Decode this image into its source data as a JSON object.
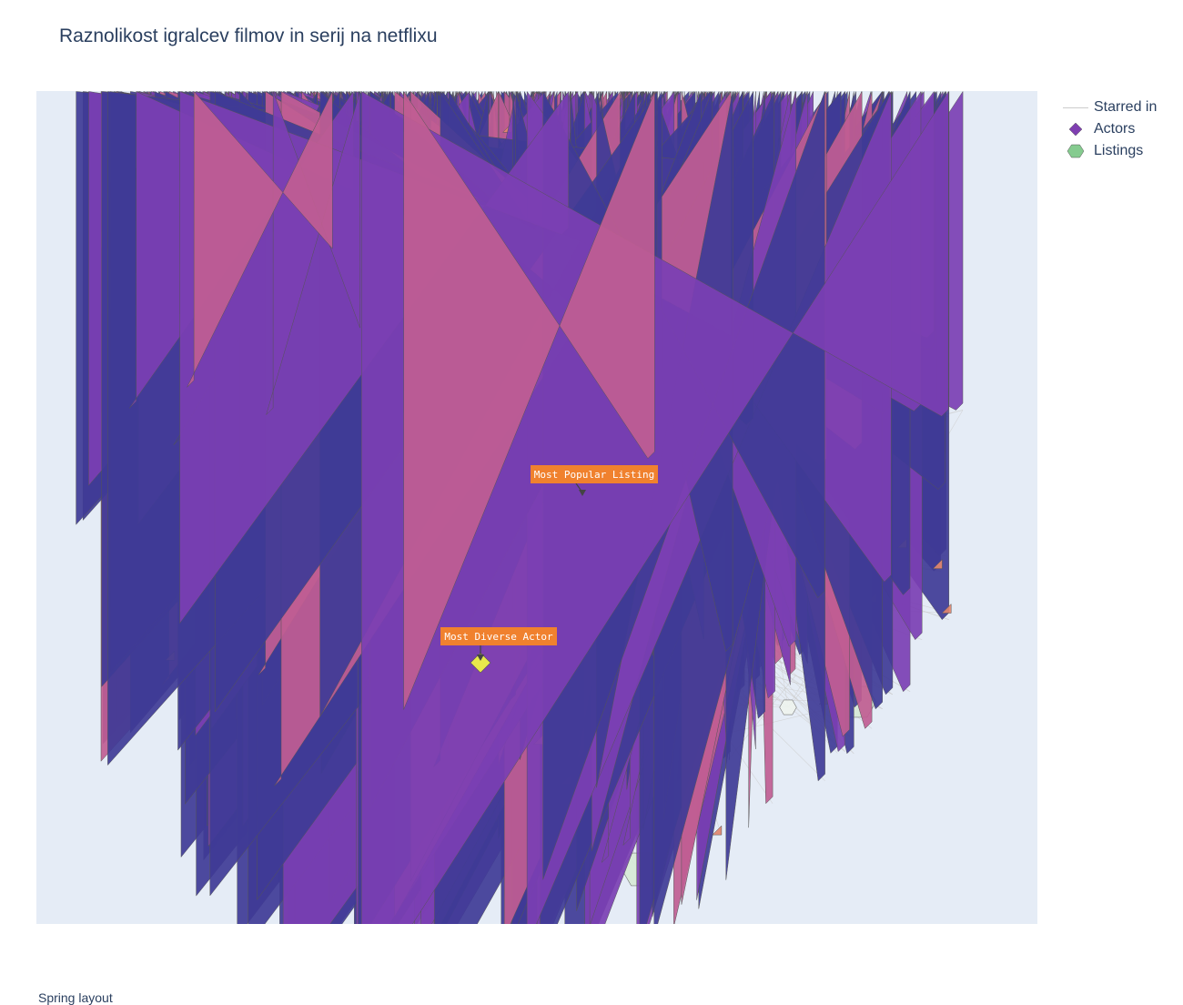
{
  "chart_data": {
    "type": "network",
    "title": "Raznolikost igralcev filmov in serij na netflixu",
    "layout_name": "Spring layout",
    "legend": {
      "placement": "top-right",
      "items": [
        {
          "name": "Starred in",
          "kind": "line",
          "color": "#cccccc"
        },
        {
          "name": "Actors",
          "kind": "diamond",
          "color": "#7f3fb1"
        },
        {
          "name": "Listings",
          "kind": "hexagon",
          "color": "#85cb8f"
        }
      ]
    },
    "grid": false,
    "axes_visible": false,
    "colors": {
      "plot_background": "#e5ecf6",
      "edge": "#cccccc",
      "actor_scale": [
        "#3f3b96",
        "#7b3fb3",
        "#c05d92",
        "#e2866e",
        "#f2b450",
        "#e8e84b"
      ],
      "listing_scale": [
        "#f2f6f2",
        "#cfe8cf",
        "#79c27e",
        "#3a9d4d",
        "#1e5c2c"
      ],
      "annotation": "#f0812e"
    },
    "annotations": [
      {
        "text": "Most Popular Listing",
        "points_to": "highest-degree listing node"
      },
      {
        "text": "Most Diverse Actor",
        "points_to": "highest-diversity actor node"
      }
    ]
  }
}
